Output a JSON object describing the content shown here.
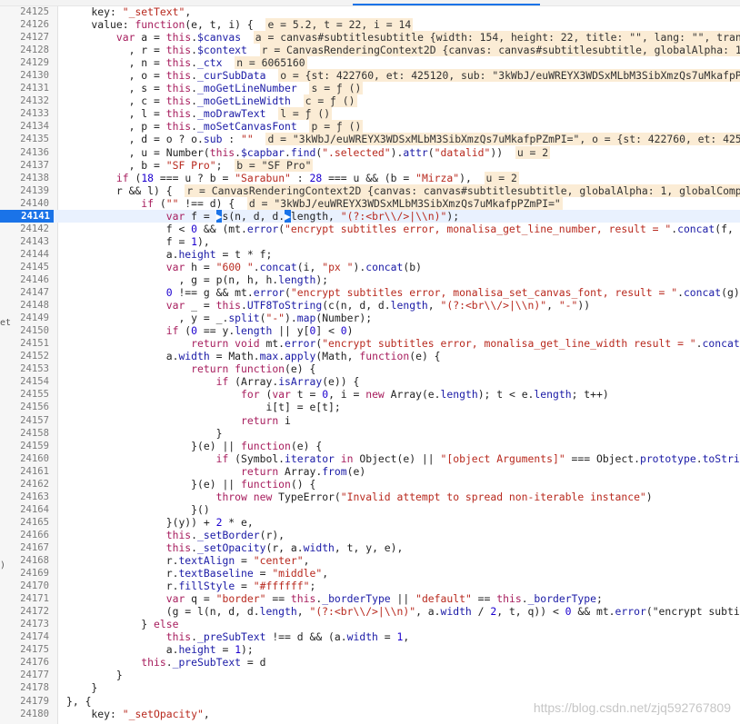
{
  "editor": {
    "current_line": "24141",
    "lines": [
      {
        "num": "24125",
        "indent": 4,
        "code": "key: \"_setText\",",
        "ann": ""
      },
      {
        "num": "24126",
        "indent": 4,
        "code": "value: function(e, t, i) {",
        "ann": "e = 5.2, t = 22, i = 14"
      },
      {
        "num": "24127",
        "indent": 8,
        "code": "var a = this.$canvas",
        "ann": "a = canvas#subtitlesubtitle {width: 154, height: 22, title: \"\", lang: \"\", transl"
      },
      {
        "num": "24128",
        "indent": 10,
        "code": ", r = this.$context",
        "ann": "r = CanvasRenderingContext2D {canvas: canvas#subtitlesubtitle, globalAlpha: 1, "
      },
      {
        "num": "24129",
        "indent": 10,
        "code": ", n = this._ctx",
        "ann": "n = 6065160"
      },
      {
        "num": "24130",
        "indent": 10,
        "code": ", o = this._curSubData",
        "ann": "o = {st: 422760, et: 425120, sub: \"3kWbJ/euWREYX3WDSxMLbM3SibXmzQs7uMkafpPZm"
      },
      {
        "num": "24131",
        "indent": 10,
        "code": ", s = this._moGetLineNumber",
        "ann": "s = ƒ ()"
      },
      {
        "num": "24132",
        "indent": 10,
        "code": ", c = this._moGetLineWidth",
        "ann": "c = ƒ ()"
      },
      {
        "num": "24133",
        "indent": 10,
        "code": ", l = this._moDrawText",
        "ann": "l = ƒ ()"
      },
      {
        "num": "24134",
        "indent": 10,
        "code": ", p = this._moSetCanvasFont",
        "ann": "p = ƒ ()"
      },
      {
        "num": "24135",
        "indent": 10,
        "code": ", d = o ? o.sub : \"\"",
        "ann": "d = \"3kWbJ/euWREYX3WDSxMLbM3SibXmzQs7uMkafpPZmPI=\", o = {st: 422760, et: 42512"
      },
      {
        "num": "24136",
        "indent": 10,
        "code": ", u = Number(this.$capbar.find(\".selected\").attr(\"datalid\"))",
        "ann": "u = 2"
      },
      {
        "num": "24137",
        "indent": 10,
        "code": ", b = \"SF Pro\";",
        "ann": "b = \"SF Pro\""
      },
      {
        "num": "24138",
        "indent": 8,
        "code": "if (18 === u ? b = \"Sarabun\" : 28 === u && (b = \"Mirza\"),",
        "ann": "u = 2"
      },
      {
        "num": "24139",
        "indent": 8,
        "code": "r && l) {",
        "ann": "r = CanvasRenderingContext2D {canvas: canvas#subtitlesubtitle, globalAlpha: 1, globalCompos"
      },
      {
        "num": "24140",
        "indent": 12,
        "code": "if (\"\" !== d) {",
        "ann": "d = \"3kWbJ/euWREYX3WDSxMLbM3SibXmzQs7uMkafpPZmPI=\""
      },
      {
        "num": "24141",
        "indent": 16,
        "code": "var f = ▶s(n, d, d.▶length, \"(?:<br\\\\/>|\\\\n)\");",
        "ann": ""
      },
      {
        "num": "24142",
        "indent": 16,
        "code": "f < 0 && (mt.error(\"encrypt subtitles error, monalisa_get_line_number, result = \".concat(f, \",",
        "ann": ""
      },
      {
        "num": "24143",
        "indent": 16,
        "code": "f = 1),",
        "ann": ""
      },
      {
        "num": "24144",
        "indent": 16,
        "code": "a.height = t * f;",
        "ann": ""
      },
      {
        "num": "24145",
        "indent": 16,
        "code": "var h = \"600 \".concat(i, \"px \").concat(b)",
        "ann": ""
      },
      {
        "num": "24146",
        "indent": 18,
        "code": ", g = p(n, h, h.length);",
        "ann": ""
      },
      {
        "num": "24147",
        "indent": 16,
        "code": "0 !== g && mt.error(\"encrypt subtitles error, monalisa_set_canvas_font, result = \".concat(g));",
        "ann": ""
      },
      {
        "num": "24148",
        "indent": 16,
        "code": "var _ = this.UTF8ToString(c(n, d, d.length, \"(?:<br\\\\/>|\\\\n)\", \"-\"))",
        "ann": ""
      },
      {
        "num": "24149",
        "indent": 18,
        "code": ", y = _.split(\"-\").map(Number);",
        "ann": ""
      },
      {
        "num": "24150",
        "indent": 16,
        "code": "if (0 == y.length || y[0] < 0)",
        "ann": ""
      },
      {
        "num": "24151",
        "indent": 20,
        "code": "return void mt.error(\"encrypt subtitles error, monalisa_get_line_width result = \".concat(_",
        "ann": ""
      },
      {
        "num": "24152",
        "indent": 16,
        "code": "a.width = Math.max.apply(Math, function(e) {",
        "ann": ""
      },
      {
        "num": "24153",
        "indent": 20,
        "code": "return function(e) {",
        "ann": ""
      },
      {
        "num": "24154",
        "indent": 24,
        "code": "if (Array.isArray(e)) {",
        "ann": ""
      },
      {
        "num": "24155",
        "indent": 28,
        "code": "for (var t = 0, i = new Array(e.length); t < e.length; t++)",
        "ann": ""
      },
      {
        "num": "24156",
        "indent": 32,
        "code": "i[t] = e[t];",
        "ann": ""
      },
      {
        "num": "24157",
        "indent": 28,
        "code": "return i",
        "ann": ""
      },
      {
        "num": "24158",
        "indent": 24,
        "code": "}",
        "ann": ""
      },
      {
        "num": "24159",
        "indent": 20,
        "code": "}(e) || function(e) {",
        "ann": ""
      },
      {
        "num": "24160",
        "indent": 24,
        "code": "if (Symbol.iterator in Object(e) || \"[object Arguments]\" === Object.prototype.toString",
        "ann": ""
      },
      {
        "num": "24161",
        "indent": 28,
        "code": "return Array.from(e)",
        "ann": ""
      },
      {
        "num": "24162",
        "indent": 20,
        "code": "}(e) || function() {",
        "ann": ""
      },
      {
        "num": "24163",
        "indent": 24,
        "code": "throw new TypeError(\"Invalid attempt to spread non-iterable instance\")",
        "ann": ""
      },
      {
        "num": "24164",
        "indent": 20,
        "code": "}()",
        "ann": ""
      },
      {
        "num": "24165",
        "indent": 16,
        "code": "}(y)) + 2 * e,",
        "ann": ""
      },
      {
        "num": "24166",
        "indent": 16,
        "code": "this._setBorder(r),",
        "ann": ""
      },
      {
        "num": "24167",
        "indent": 16,
        "code": "this._setOpacity(r, a.width, t, y, e),",
        "ann": ""
      },
      {
        "num": "24168",
        "indent": 16,
        "code": "r.textAlign = \"center\",",
        "ann": ""
      },
      {
        "num": "24169",
        "indent": 16,
        "code": "r.textBaseline = \"middle\",",
        "ann": ""
      },
      {
        "num": "24170",
        "indent": 16,
        "code": "r.fillStyle = \"#ffffff\";",
        "ann": ""
      },
      {
        "num": "24171",
        "indent": 16,
        "code": "var q = \"border\" == this._borderType || \"default\" == this._borderType;",
        "ann": ""
      },
      {
        "num": "24172",
        "indent": 16,
        "code": "(g = l(n, d, d.length, \"(?:<br\\\\/>|\\\\n)\", a.width / 2, t, q)) < 0 && mt.error(\"encrypt subtitle",
        "ann": ""
      },
      {
        "num": "24173",
        "indent": 12,
        "code": "} else",
        "ann": ""
      },
      {
        "num": "24174",
        "indent": 16,
        "code": "this._preSubText !== d && (a.width = 1,",
        "ann": ""
      },
      {
        "num": "24175",
        "indent": 16,
        "code": "a.height = 1);",
        "ann": ""
      },
      {
        "num": "24176",
        "indent": 12,
        "code": "this._preSubText = d",
        "ann": ""
      },
      {
        "num": "24177",
        "indent": 8,
        "code": "}",
        "ann": ""
      },
      {
        "num": "24178",
        "indent": 4,
        "code": "}",
        "ann": ""
      },
      {
        "num": "24179",
        "indent": 0,
        "code": "}, {",
        "ann": ""
      },
      {
        "num": "24180",
        "indent": 4,
        "code": "key: \"_setOpacity\",",
        "ann": ""
      }
    ]
  },
  "left_fragments": [
    {
      "text": "et",
      "line": "24149"
    },
    {
      "text": ")",
      "line": "24168"
    }
  ],
  "watermark": "https://blog.csdn.net/zjq592767809",
  "colors": {
    "current_line_bg": "#e9f1fe",
    "current_line_marker": "#1a73e8",
    "annotation_bg": "#fbecd5"
  }
}
